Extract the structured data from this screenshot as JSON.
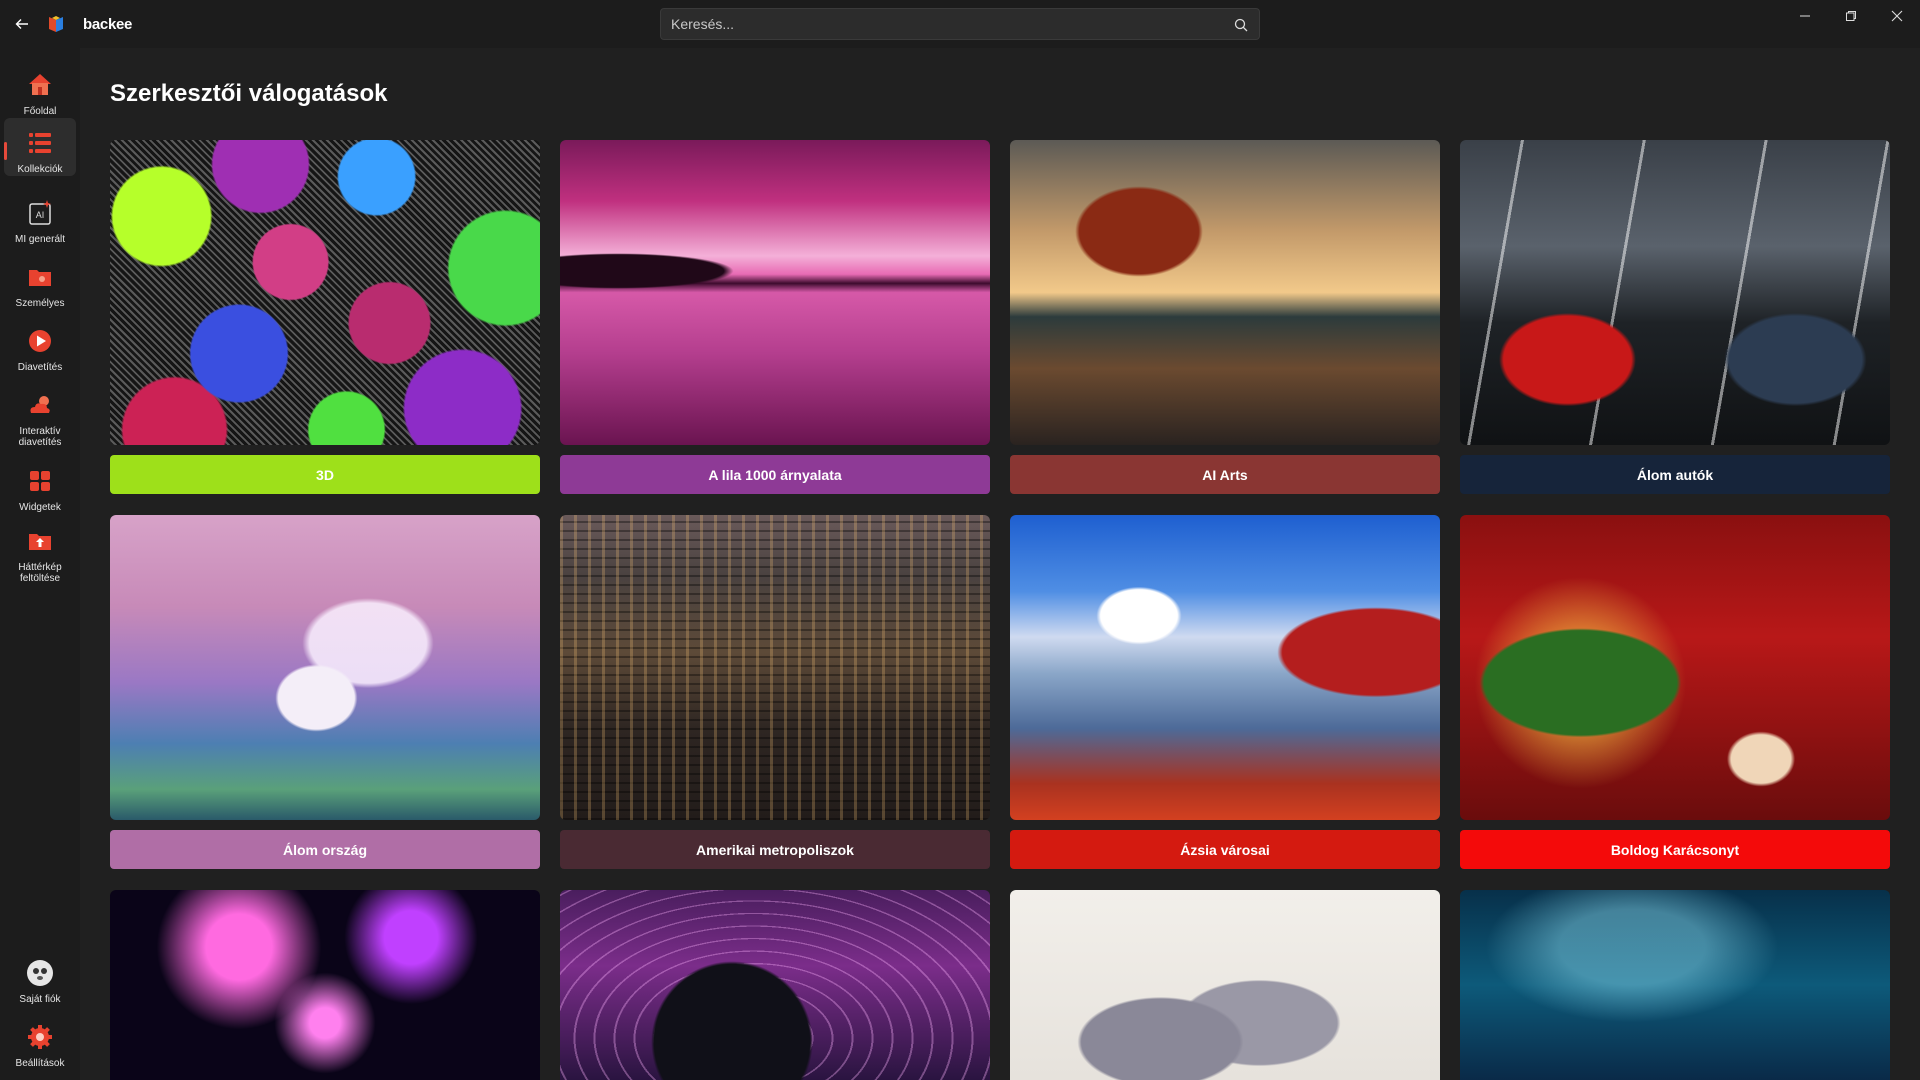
{
  "app": {
    "title": "backee",
    "search_placeholder": "Keresés..."
  },
  "sidebar": {
    "items": [
      {
        "label": "Főoldal",
        "icon": "home-icon"
      },
      {
        "label": "Kollekciók",
        "icon": "collections-icon",
        "active": true
      },
      {
        "label": "MI generált",
        "icon": "ai-generated-icon"
      },
      {
        "label": "Személyes",
        "icon": "personal-folder-icon"
      },
      {
        "label": "Diavetítés",
        "icon": "slideshow-play-icon"
      },
      {
        "label": "Interaktív diavetítés",
        "icon": "weather-interactive-icon"
      },
      {
        "label": "Widgetek",
        "icon": "widgets-icon"
      },
      {
        "label": "Háttérkép feltöltése",
        "icon": "upload-wallpaper-icon"
      }
    ],
    "bottom": [
      {
        "label": "Saját fiók",
        "icon": "account-avatar-icon"
      },
      {
        "label": "Beállítások",
        "icon": "settings-gear-icon"
      }
    ]
  },
  "main": {
    "title": "Szerkesztői válogatások",
    "collections": [
      {
        "label": "3D",
        "color": "#9ee01a"
      },
      {
        "label": "A lila 1000 árnyalata",
        "color": "#8e3a96"
      },
      {
        "label": "AI Arts",
        "color": "#8a3633"
      },
      {
        "label": "Álom autók",
        "color": "#16243a"
      },
      {
        "label": "Álom ország",
        "color": "#b06ea6"
      },
      {
        "label": "Amerikai metropoliszok",
        "color": "#4a2a33"
      },
      {
        "label": "Ázsia városai",
        "color": "#d41a10"
      },
      {
        "label": "Boldog Karácsonyt",
        "color": "#f40a0a"
      }
    ]
  },
  "colors": {
    "background": "#202020",
    "sidebar": "#1c1c1c",
    "accent": "#e64a3b"
  }
}
